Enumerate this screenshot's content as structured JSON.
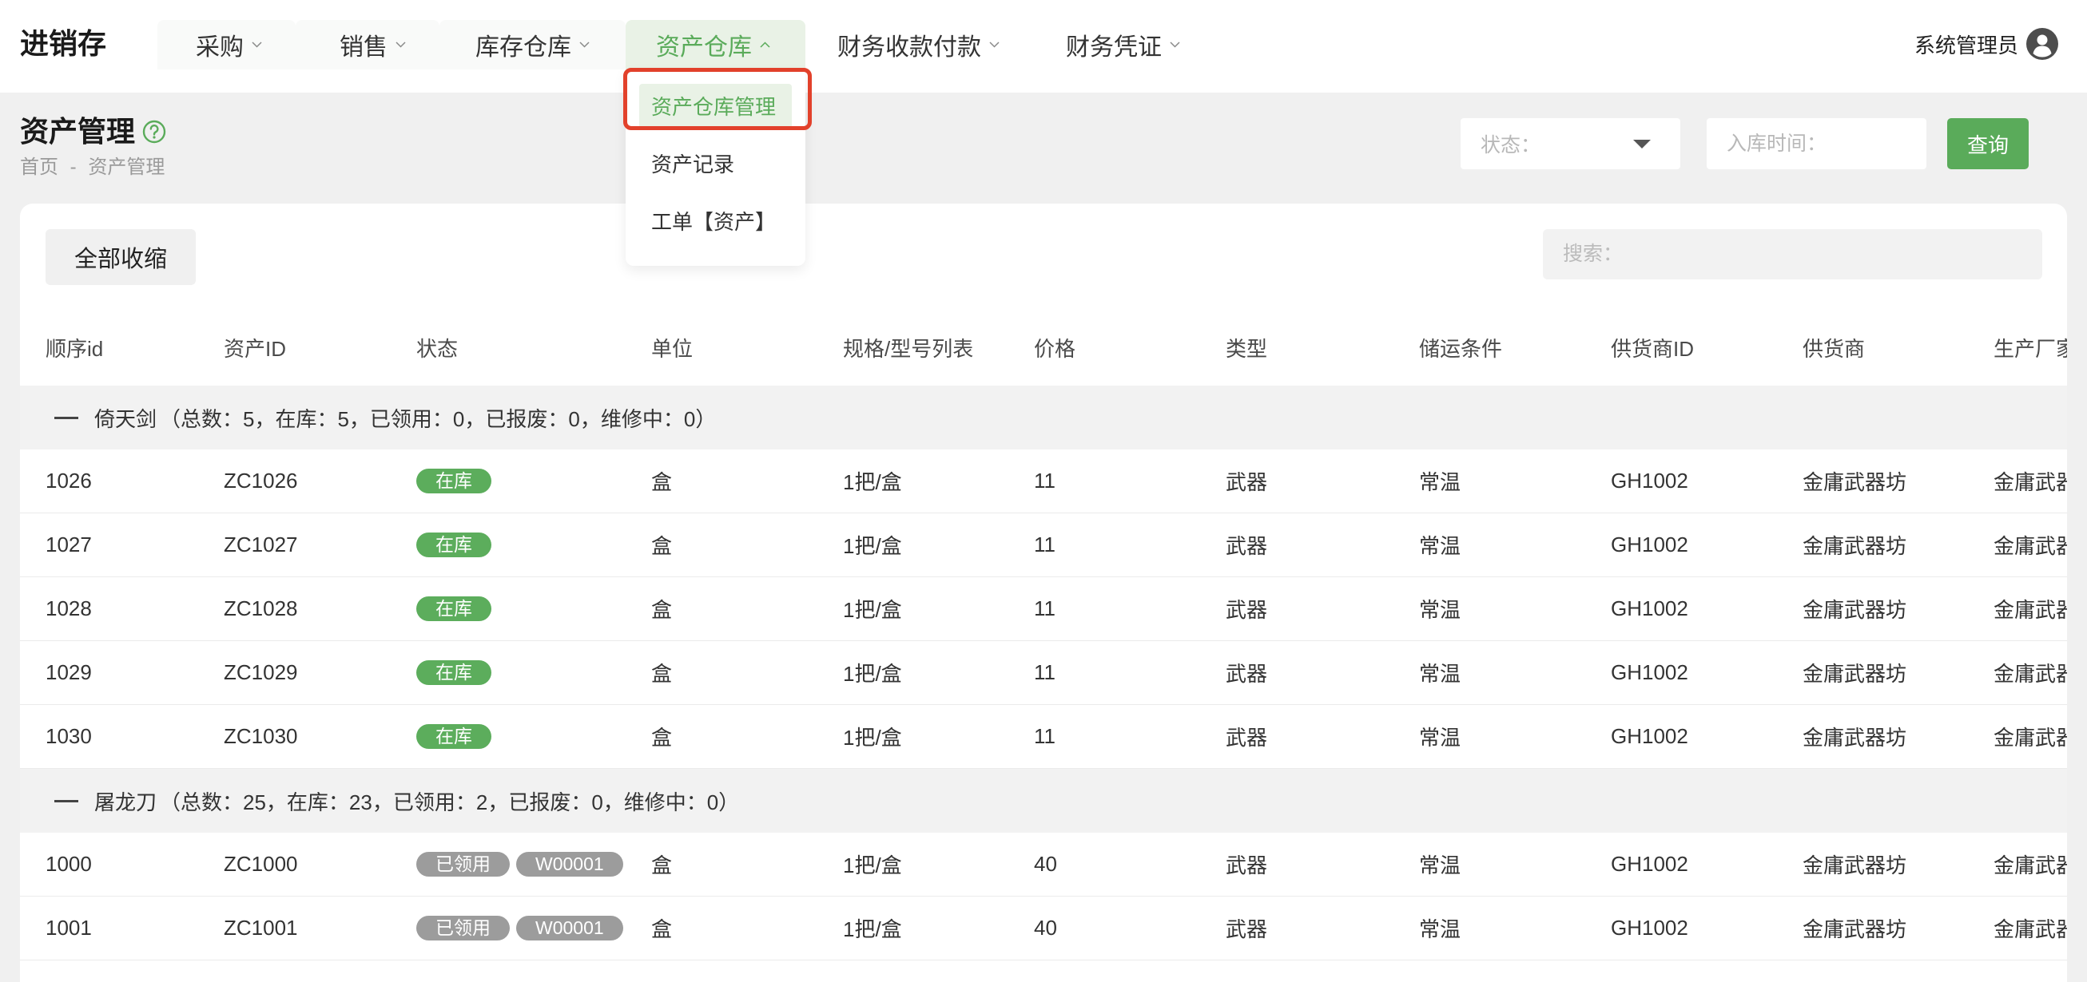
{
  "app": {
    "logo": "进销存"
  },
  "nav": {
    "items": [
      {
        "label": "采购",
        "icon": "chevron-down-icon"
      },
      {
        "label": "销售",
        "icon": "chevron-down-icon"
      },
      {
        "label": "库存仓库",
        "icon": "chevron-down-icon"
      },
      {
        "label": "资产仓库",
        "icon": "chevron-up-icon",
        "active": true
      },
      {
        "label": "财务收款付款",
        "icon": "chevron-down-icon"
      },
      {
        "label": "财务凭证",
        "icon": "chevron-down-icon"
      }
    ],
    "dropdown": {
      "items": [
        {
          "label": "资产仓库管理",
          "selected": true,
          "highlighted": true
        },
        {
          "label": "资产记录"
        },
        {
          "label": "工单【资产】"
        }
      ]
    }
  },
  "user": {
    "name": "系统管理员",
    "icon": "user-avatar-icon"
  },
  "page": {
    "title": "资产管理",
    "help_icon": "question-circle-icon",
    "breadcrumb": {
      "home": "首页",
      "separator": "-",
      "current": "资产管理"
    }
  },
  "filters": {
    "status_placeholder": "状态：",
    "status_icon": "caret-down-icon",
    "date_placeholder": "入库时间：",
    "query_label": "查询"
  },
  "toolbar": {
    "collapse_all_label": "全部收缩",
    "search_placeholder": "搜索："
  },
  "table": {
    "columns": [
      "顺序id",
      "资产ID",
      "状态",
      "单位",
      "规格/型号列表",
      "价格",
      "类型",
      "储运条件",
      "供货商ID",
      "供货商",
      "生产厂家"
    ],
    "groups": [
      {
        "name": "倚天剑",
        "summary": "（总数：5，在库：5，已领用：0，已报废：0，维修中：0）",
        "rows": [
          {
            "seq_id": "1026",
            "asset_id": "ZC1026",
            "status": [
              {
                "text": "在库",
                "color": "#5cad5c"
              }
            ],
            "unit": "盒",
            "spec": "1把/盒",
            "price": "11",
            "type": "武器",
            "storage": "常温",
            "supplier_id": "GH1002",
            "supplier": "金庸武器坊",
            "manufacturer": "金庸武器"
          },
          {
            "seq_id": "1027",
            "asset_id": "ZC1027",
            "status": [
              {
                "text": "在库",
                "color": "#5cad5c"
              }
            ],
            "unit": "盒",
            "spec": "1把/盒",
            "price": "11",
            "type": "武器",
            "storage": "常温",
            "supplier_id": "GH1002",
            "supplier": "金庸武器坊",
            "manufacturer": "金庸武器"
          },
          {
            "seq_id": "1028",
            "asset_id": "ZC1028",
            "status": [
              {
                "text": "在库",
                "color": "#5cad5c"
              }
            ],
            "unit": "盒",
            "spec": "1把/盒",
            "price": "11",
            "type": "武器",
            "storage": "常温",
            "supplier_id": "GH1002",
            "supplier": "金庸武器坊",
            "manufacturer": "金庸武器"
          },
          {
            "seq_id": "1029",
            "asset_id": "ZC1029",
            "status": [
              {
                "text": "在库",
                "color": "#5cad5c"
              }
            ],
            "unit": "盒",
            "spec": "1把/盒",
            "price": "11",
            "type": "武器",
            "storage": "常温",
            "supplier_id": "GH1002",
            "supplier": "金庸武器坊",
            "manufacturer": "金庸武器"
          },
          {
            "seq_id": "1030",
            "asset_id": "ZC1030",
            "status": [
              {
                "text": "在库",
                "color": "#5cad5c"
              }
            ],
            "unit": "盒",
            "spec": "1把/盒",
            "price": "11",
            "type": "武器",
            "storage": "常温",
            "supplier_id": "GH1002",
            "supplier": "金庸武器坊",
            "manufacturer": "金庸武器"
          }
        ]
      },
      {
        "name": "屠龙刀",
        "summary": "（总数：25，在库：23，已领用：2，已报废：0，维修中：0）",
        "rows": [
          {
            "seq_id": "1000",
            "asset_id": "ZC1000",
            "status": [
              {
                "text": "已领用",
                "color": "#9c9c9c"
              },
              {
                "text": "W00001",
                "color": "#9c9c9c"
              }
            ],
            "unit": "盒",
            "spec": "1把/盒",
            "price": "40",
            "type": "武器",
            "storage": "常温",
            "supplier_id": "GH1002",
            "supplier": "金庸武器坊",
            "manufacturer": "金庸武器"
          },
          {
            "seq_id": "1001",
            "asset_id": "ZC1001",
            "status": [
              {
                "text": "已领用",
                "color": "#9c9c9c"
              },
              {
                "text": "W00001",
                "color": "#9c9c9c"
              }
            ],
            "unit": "盒",
            "spec": "1把/盒",
            "price": "40",
            "type": "武器",
            "storage": "常温",
            "supplier_id": "GH1002",
            "supplier": "金庸武器坊",
            "manufacturer": "金庸武器"
          }
        ]
      }
    ]
  },
  "colors": {
    "accent": "#5aab5a",
    "accent_light": "#e9f2e6",
    "highlight_border": "#e2412b",
    "page_bg": "#f0f0f0"
  }
}
